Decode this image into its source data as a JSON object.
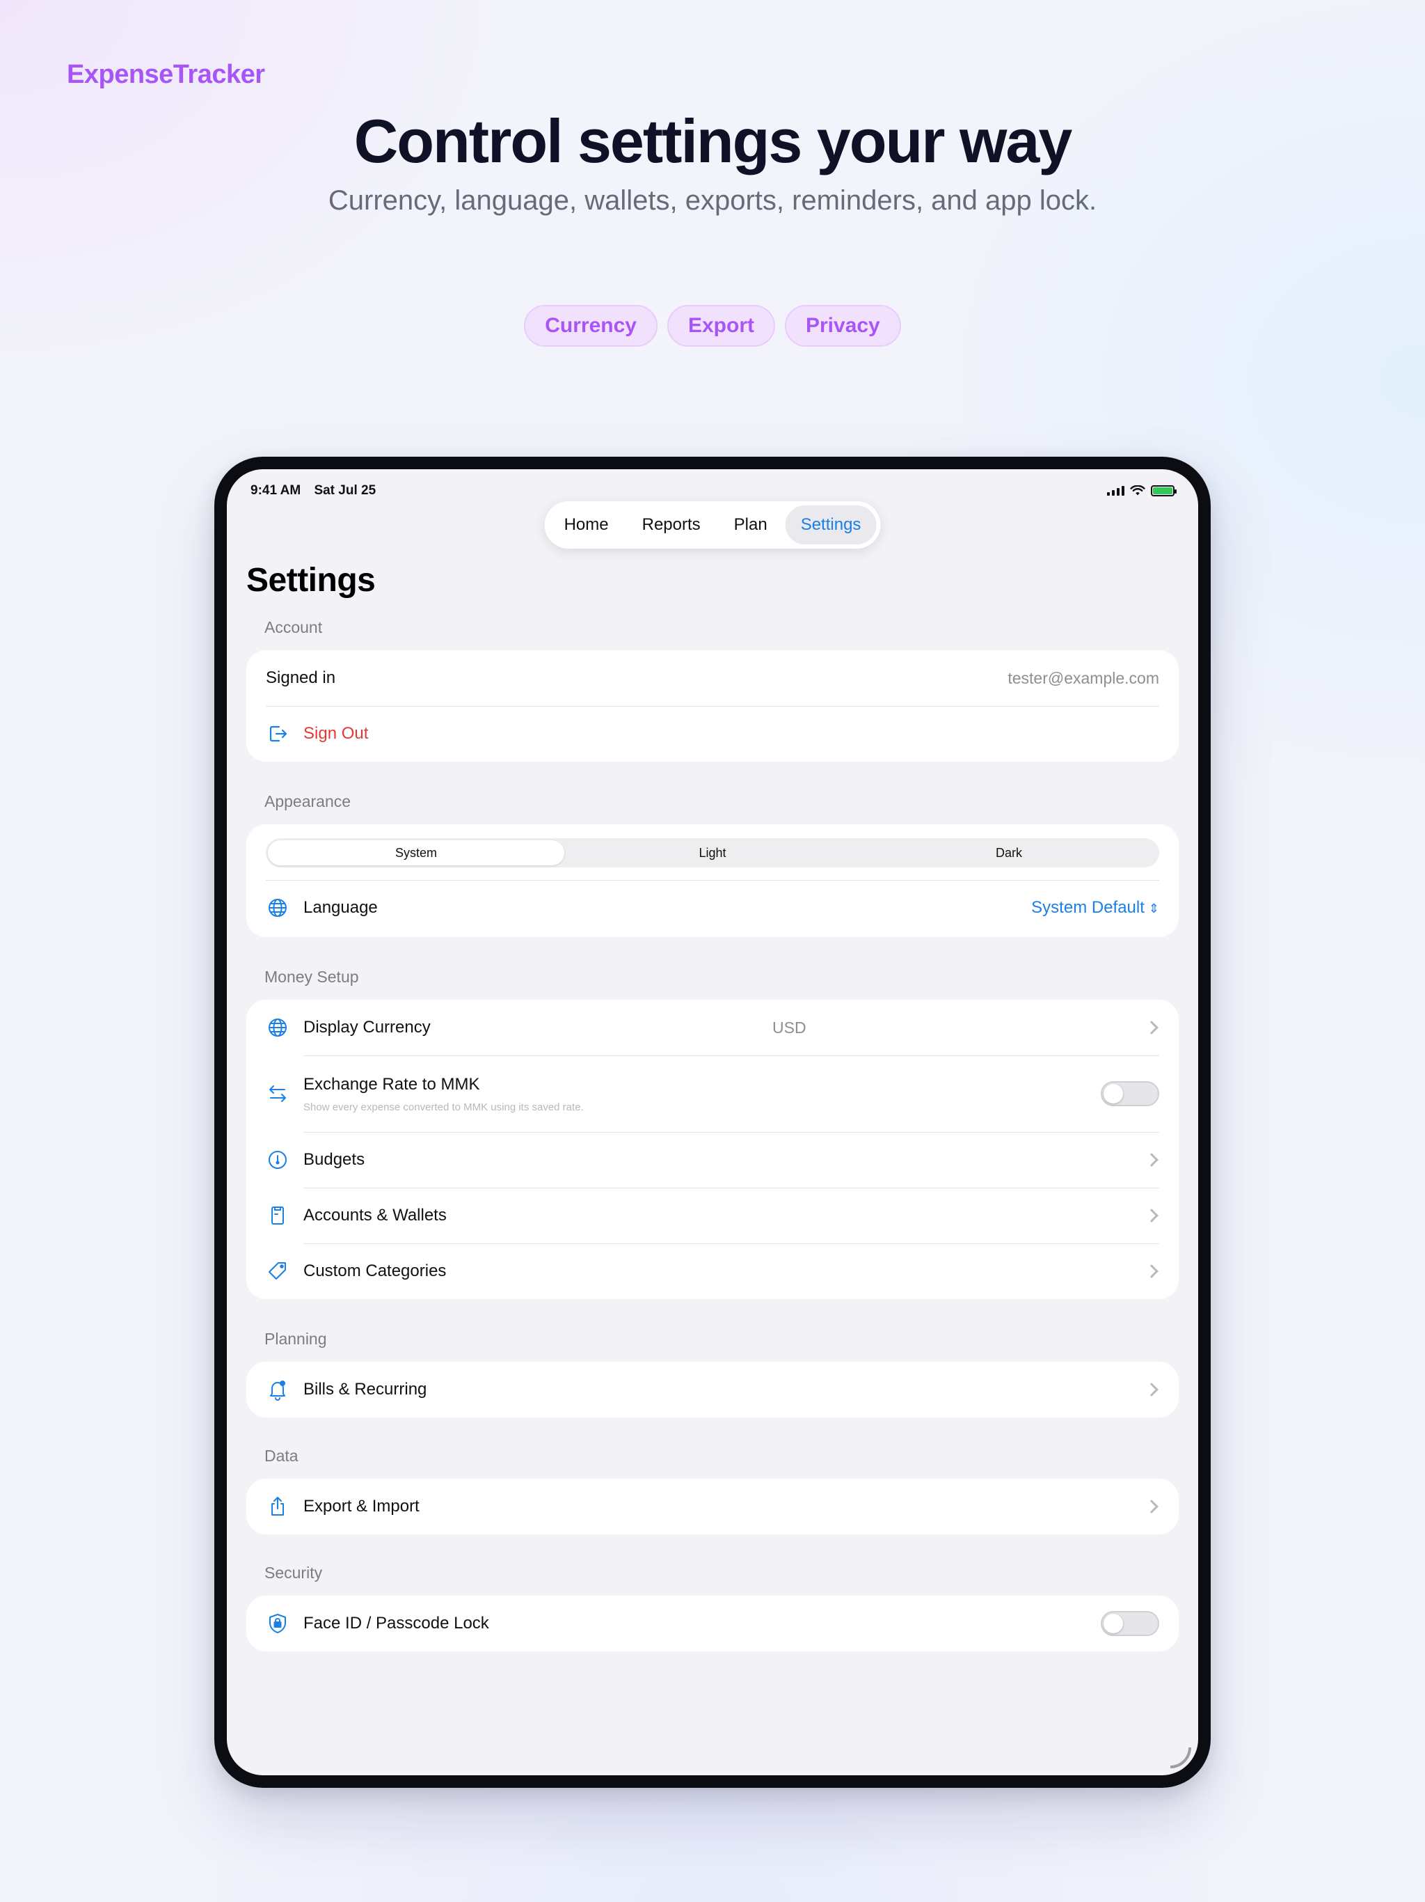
{
  "marketing": {
    "brand": "ExpenseTracker",
    "headline": "Control settings your way",
    "subhead": "Currency, language, wallets, exports, reminders, and app lock.",
    "chips": [
      "Currency",
      "Export",
      "Privacy"
    ]
  },
  "status_bar": {
    "time": "9:41 AM",
    "date": "Sat Jul 25"
  },
  "tabs": [
    {
      "label": "Home"
    },
    {
      "label": "Reports"
    },
    {
      "label": "Plan"
    },
    {
      "label": "Settings",
      "active": true
    }
  ],
  "page_title": "Settings",
  "sections": {
    "account": {
      "label": "Account",
      "signed_in_label": "Signed in",
      "email": "tester@example.com",
      "sign_out": "Sign Out"
    },
    "appearance": {
      "label": "Appearance",
      "segments": [
        "System",
        "Light",
        "Dark"
      ],
      "selected": "System",
      "language_label": "Language",
      "language_value": "System Default"
    },
    "money_setup": {
      "label": "Money Setup",
      "display_currency_label": "Display Currency",
      "display_currency_value": "USD",
      "exchange_label": "Exchange Rate to MMK",
      "exchange_sub": "Show every expense converted to MMK using its saved rate.",
      "exchange_on": false,
      "budgets": "Budgets",
      "accounts": "Accounts & Wallets",
      "categories": "Custom Categories"
    },
    "planning": {
      "label": "Planning",
      "bills": "Bills & Recurring"
    },
    "data": {
      "label": "Data",
      "export": "Export & Import"
    },
    "security": {
      "label": "Security",
      "lock": "Face ID / Passcode Lock",
      "lock_on": false
    }
  },
  "colors": {
    "brand_purple": "#a855f7",
    "accent_blue": "#1a7fe6",
    "destructive_red": "#e53935"
  }
}
